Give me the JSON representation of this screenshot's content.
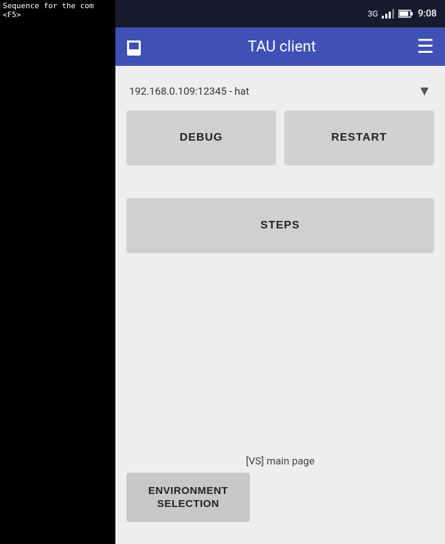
{
  "terminal": {
    "line1": "Sequence for the com",
    "line2": "<F5>"
  },
  "statusBar": {
    "network": "3G",
    "time": "9:08",
    "battery_icon": "🔋",
    "sim_icon": "📶"
  },
  "appBar": {
    "title": "TAU client",
    "menu_icon": "☰"
  },
  "content": {
    "dropdown": {
      "value": "192.168.0.109:12345 - hat",
      "arrow": "▼"
    },
    "debug_button": "DEBUG",
    "restart_button": "RESTART",
    "steps_button": "STEPS",
    "vs_label": "[VS] main page",
    "env_button_line1": "ENVIRONMENT",
    "env_button_line2": "SELECTION"
  }
}
